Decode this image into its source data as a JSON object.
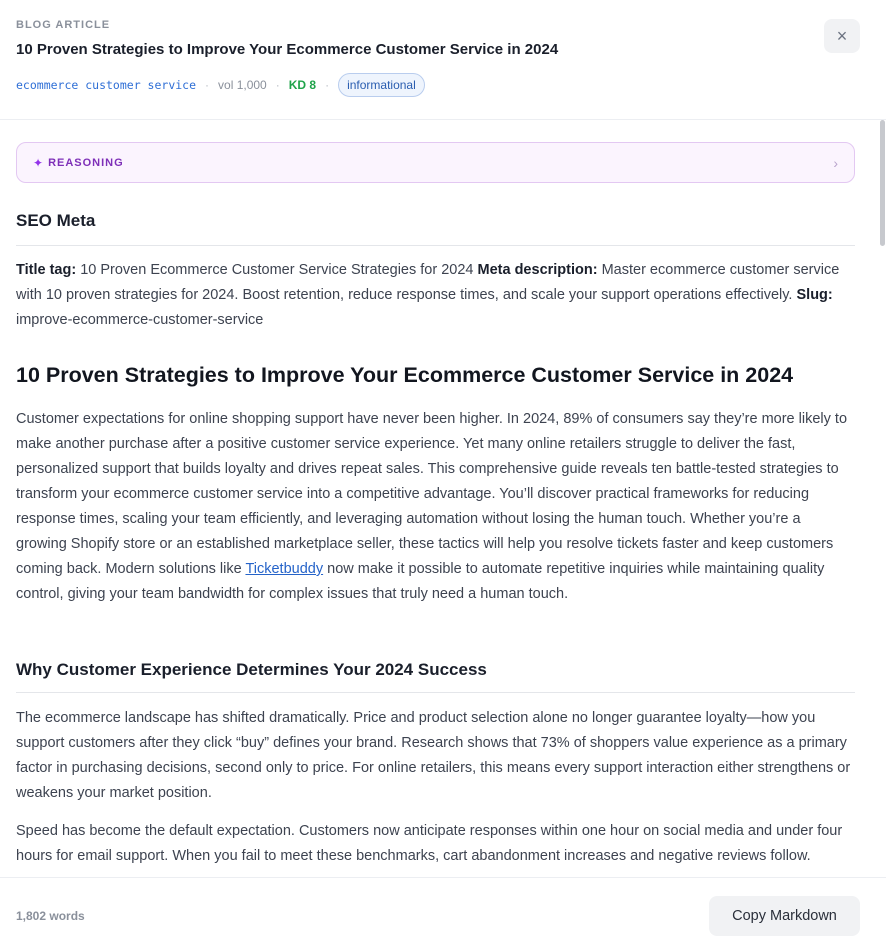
{
  "header": {
    "eyebrow": "BLOG ARTICLE",
    "title": "10 Proven Strategies to Improve Your Ecommerce Customer Service in 2024",
    "keyword": "ecommerce customer service",
    "volume": "vol 1,000",
    "kd": "KD 8",
    "intent": "informational",
    "close_icon": "×"
  },
  "reasoning": {
    "icon": "✦",
    "label": "REASONING",
    "chevron": "›"
  },
  "seo": {
    "heading": "SEO Meta",
    "title_tag_label": "Title tag:",
    "title_tag": "10 Proven Ecommerce Customer Service Strategies for 2024",
    "meta_label": "Meta description:",
    "meta": "Master ecommerce customer service with 10 proven strategies for 2024. Boost retention, reduce response times, and scale your support operations effectively.",
    "slug_label": "Slug:",
    "slug": "improve-ecommerce-customer-service"
  },
  "article": {
    "h1": "10 Proven Strategies to Improve Your Ecommerce Customer Service in 2024",
    "intro_before_link": "Customer expectations for online shopping support have never been higher. In 2024, 89% of consumers say they’re more likely to make another purchase after a positive customer service experience. Yet many online retailers struggle to deliver the fast, personalized support that builds loyalty and drives repeat sales. This comprehensive guide reveals ten battle-tested strategies to transform your ecommerce customer service into a competitive advantage. You’ll discover practical frameworks for reducing response times, scaling your team efficiently, and leveraging automation without losing the human touch. Whether you’re a growing Shopify store or an established marketplace seller, these tactics will help you resolve tickets faster and keep customers coming back. Modern solutions like",
    "intro_link": "Ticketbuddy",
    "intro_after_link": "now make it possible to automate repetitive inquiries while maintaining quality control, giving your team bandwidth for complex issues that truly need a human touch.",
    "section_heading": "Why Customer Experience Determines Your 2024 Success",
    "section_p1": "The ecommerce landscape has shifted dramatically. Price and product selection alone no longer guarantee loyalty—how you support customers after they click “buy” defines your brand. Research shows that 73% of shoppers value experience as a primary factor in purchasing decisions, second only to price. For online retailers, this means every support interaction either strengthens or weakens your market position.",
    "section_p2": "Speed has become the default expectation. Customers now anticipate responses within one hour on social media and under four hours for email support. When you fail to meet these benchmarks, cart abandonment increases and negative reviews follow."
  },
  "footer": {
    "word_count": "1,802 words",
    "copy_label": "Copy Markdown"
  }
}
